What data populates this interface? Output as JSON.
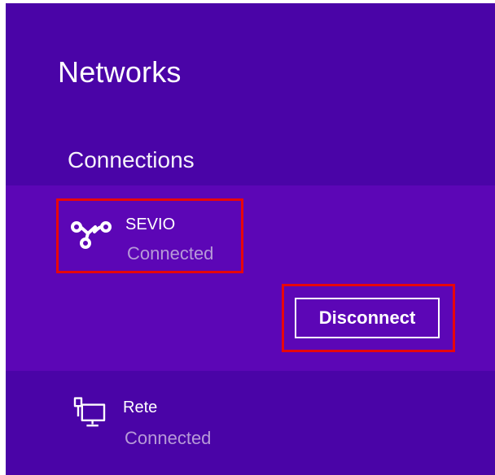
{
  "panel": {
    "title": "Networks",
    "background_color": "#4a04a7",
    "selected_background_color": "#5c06b6",
    "highlight_color": "#e8060b"
  },
  "connections": {
    "section_title": "Connections",
    "items": [
      {
        "name": "SEVIO",
        "status": "Connected",
        "icon": "mobile-broadband-icon",
        "selected": true,
        "action_label": "Disconnect"
      },
      {
        "name": "Rete",
        "status": "Connected",
        "icon": "wired-ethernet-icon",
        "selected": false
      }
    ]
  }
}
